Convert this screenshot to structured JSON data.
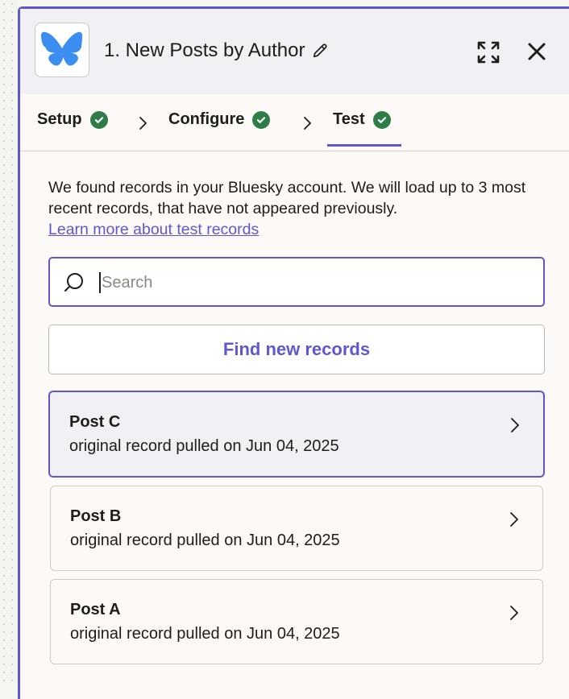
{
  "header": {
    "title": "1. New Posts by Author",
    "app_icon": "bluesky-butterfly-icon",
    "edit_icon": "pencil-icon",
    "expand_icon": "expand-icon",
    "close_icon": "close-icon"
  },
  "tabs": [
    {
      "label": "Setup",
      "status": "complete"
    },
    {
      "label": "Configure",
      "status": "complete"
    },
    {
      "label": "Test",
      "status": "complete",
      "active": true
    }
  ],
  "intro": {
    "text": "We found records in your Bluesky account. We will load up to 3 most recent records, that have not appeared previously.",
    "link_label": "Learn more about test records"
  },
  "search": {
    "placeholder": "Search",
    "value": ""
  },
  "find_button": {
    "label": "Find new records"
  },
  "records": [
    {
      "title": "Post C",
      "subtitle": "original record pulled on Jun 04, 2025",
      "selected": true
    },
    {
      "title": "Post B",
      "subtitle": "original record pulled on Jun 04, 2025",
      "selected": false
    },
    {
      "title": "Post A",
      "subtitle": "original record pulled on Jun 04, 2025",
      "selected": false
    }
  ],
  "colors": {
    "accent": "#5f58cc",
    "success": "#2f7d46",
    "bluesky": "#3b8ef0",
    "panel_bg": "#fcf9f7",
    "header_bg": "#f0f0f5"
  }
}
